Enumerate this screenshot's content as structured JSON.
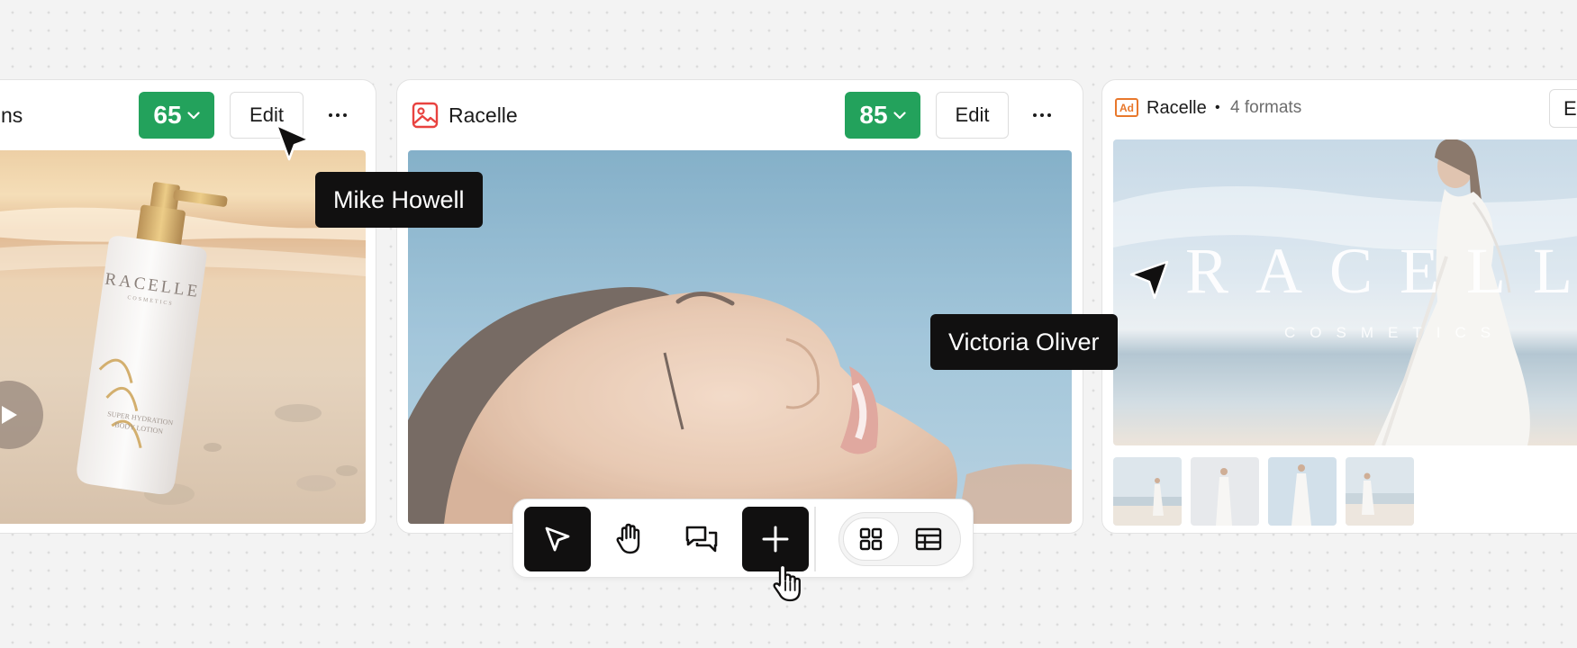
{
  "cards": [
    {
      "title": "ns",
      "score": "65",
      "edit_label": "Edit",
      "media_brand": "RACELLE",
      "media_brand_sub": "COSMETICS",
      "media_product_line1": "SUPER HYDRATION",
      "media_product_line2": "BODY LOTION",
      "media_type": "video"
    },
    {
      "title": "Racelle",
      "score": "85",
      "edit_label": "Edit",
      "type_icon": "image-icon",
      "media_type": "image"
    },
    {
      "badge": "Ad",
      "title": "Racelle",
      "separator": "•",
      "formats": "4 formats",
      "edit_label": "Ed",
      "media_brand": "RACELLE",
      "media_brand_sub": "COSMETICS",
      "thumbnail_count": 4
    }
  ],
  "collaborators": [
    {
      "name": "Mike Howell"
    },
    {
      "name": "Victoria Oliver"
    }
  ],
  "toolbar": {
    "tools": [
      "select-tool",
      "hand-tool",
      "comment-tool",
      "add-tool"
    ],
    "active_tools": [
      "select-tool",
      "add-tool"
    ],
    "views": [
      "grid-view",
      "table-view"
    ],
    "active_view": "grid-view"
  },
  "colors": {
    "score_badge": "#23a25c",
    "dark": "#111010",
    "image_icon": "#e8423f",
    "ad_badge": "#e8782c",
    "canvas": "#f3f3f3"
  }
}
